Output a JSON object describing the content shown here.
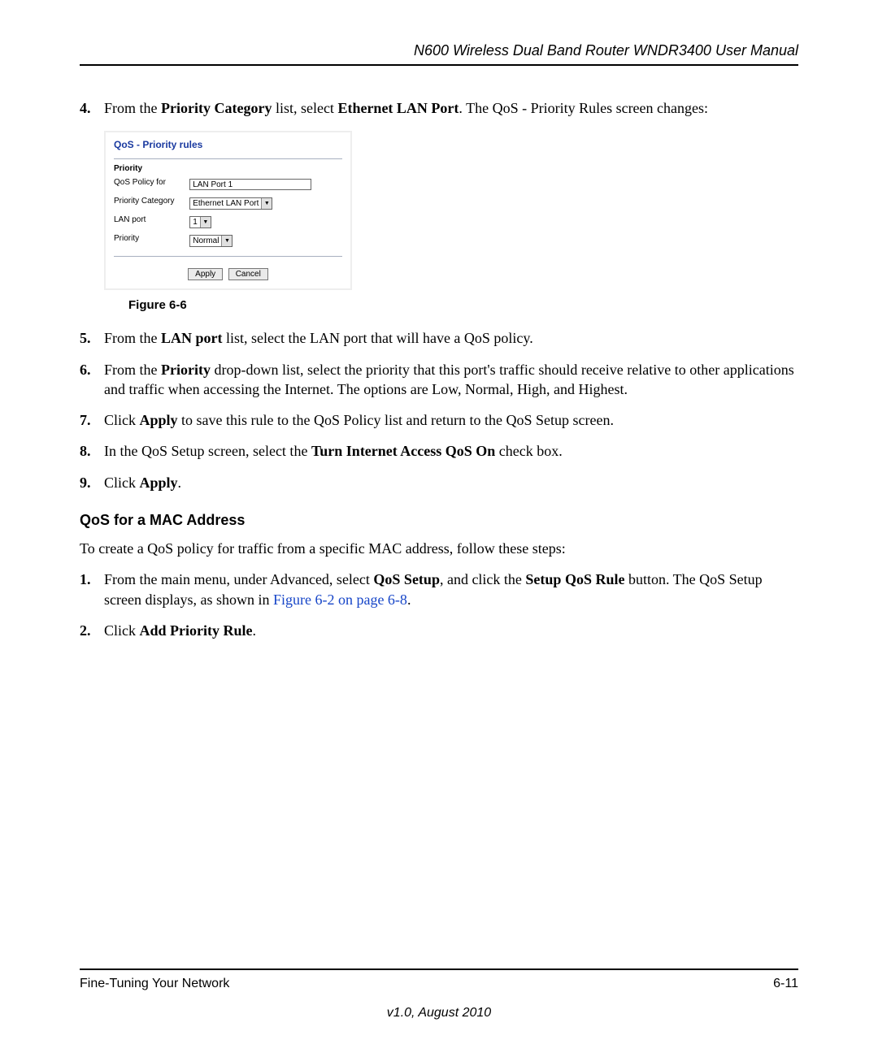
{
  "header": {
    "title": "N600 Wireless Dual Band Router WNDR3400 User Manual"
  },
  "steps_a": [
    {
      "n": "4.",
      "html": "From the <b>Priority Category</b> list, select <b>Ethernet LAN Port</b>. The QoS - Priority Rules screen changes:"
    }
  ],
  "figure": {
    "panel_title": "QoS - Priority rules",
    "section_label": "Priority",
    "rows": {
      "policy_for_label": "QoS Policy for",
      "policy_for_value": "LAN Port 1",
      "category_label": "Priority Category",
      "category_value": "Ethernet LAN Port",
      "lanport_label": "LAN port",
      "lanport_value": "1",
      "priority_label": "Priority",
      "priority_value": "Normal"
    },
    "buttons": {
      "apply": "Apply",
      "cancel": "Cancel"
    },
    "caption": "Figure 6-6"
  },
  "steps_b": [
    {
      "n": "5.",
      "html": "From the <b>LAN port</b> list, select the LAN port that will have a QoS policy."
    },
    {
      "n": "6.",
      "html": "From the <b>Priority</b> drop-down list, select the priority that this port's traffic should receive relative to other applications and traffic when accessing the Internet. The options are Low, Normal, High, and Highest."
    },
    {
      "n": "7.",
      "html": "Click <b>Apply</b> to save this rule to the QoS Policy list and return to the QoS Setup screen."
    },
    {
      "n": "8.",
      "html": "In the QoS Setup screen, select the <b>Turn Internet Access QoS On</b> check box."
    },
    {
      "n": "9.",
      "html": "Click <b>Apply</b>."
    }
  ],
  "section2": {
    "heading": "QoS for a MAC Address",
    "intro": "To create a QoS policy for traffic from a specific MAC address, follow these steps:",
    "steps": [
      {
        "n": "1.",
        "html": "From the main menu, under Advanced, select <b>QoS Setup</b>, and click the <b>Setup QoS Rule</b> button. The QoS Setup screen displays, as shown in <a class=\"xref\" href=\"#\">Figure 6-2 on page 6-8</a>."
      },
      {
        "n": "2.",
        "html": "Click <b>Add Priority Rule</b>."
      }
    ]
  },
  "footer": {
    "left": "Fine-Tuning Your Network",
    "right": "6-11",
    "version": "v1.0, August 2010"
  }
}
